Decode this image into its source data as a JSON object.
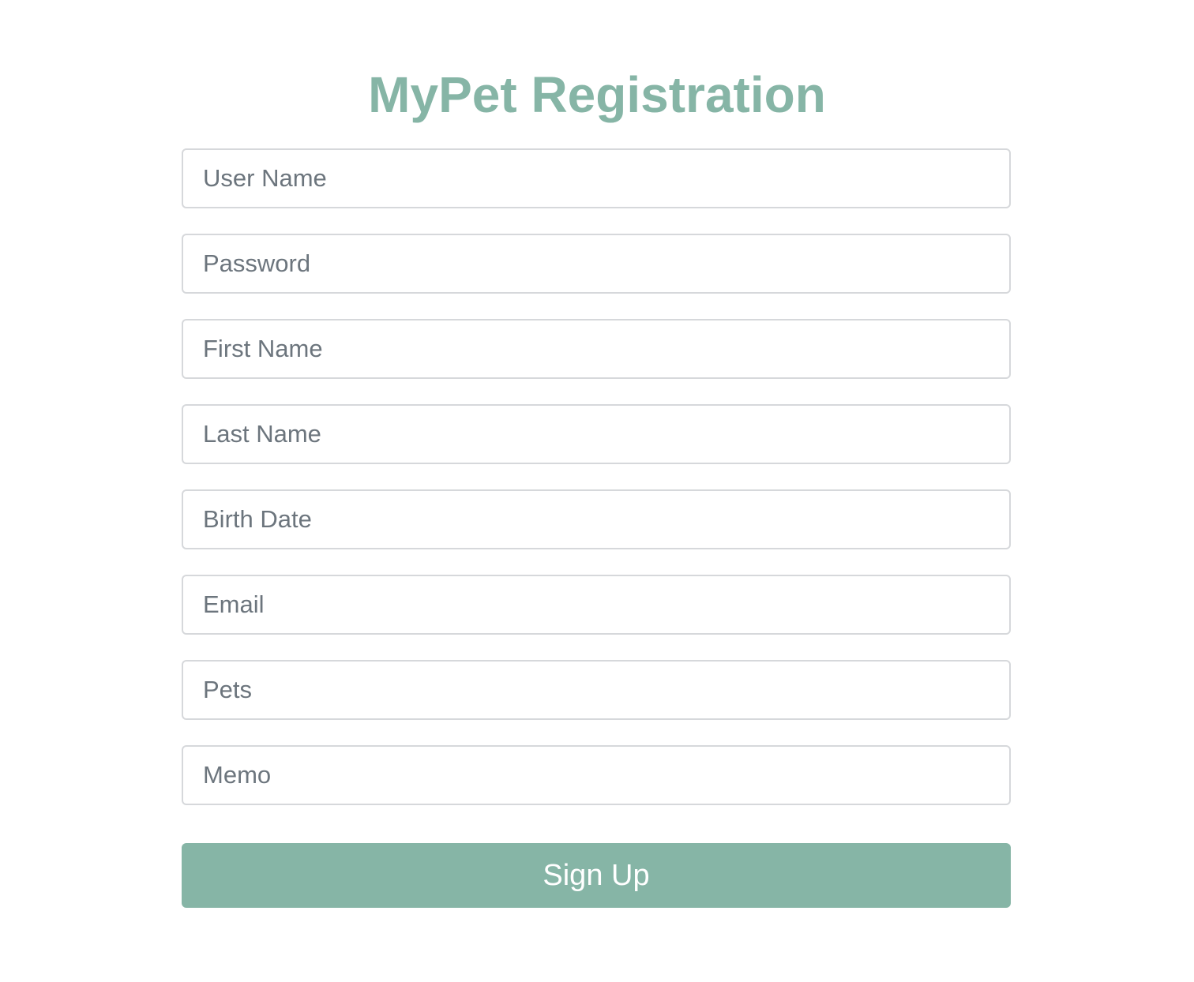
{
  "page": {
    "title": "MyPet Registration"
  },
  "form": {
    "fields": [
      {
        "name": "username",
        "placeholder": "User Name",
        "value": ""
      },
      {
        "name": "password",
        "placeholder": "Password",
        "value": ""
      },
      {
        "name": "first_name",
        "placeholder": "First Name",
        "value": ""
      },
      {
        "name": "last_name",
        "placeholder": "Last Name",
        "value": ""
      },
      {
        "name": "birth_date",
        "placeholder": "Birth Date",
        "value": ""
      },
      {
        "name": "email",
        "placeholder": "Email",
        "value": ""
      },
      {
        "name": "pets",
        "placeholder": "Pets",
        "value": ""
      },
      {
        "name": "memo",
        "placeholder": "Memo",
        "value": ""
      }
    ],
    "submit_label": "Sign Up"
  },
  "colors": {
    "accent": "#86b5a6",
    "border": "#d6d8db",
    "placeholder": "#6c757d",
    "background": "#ffffff"
  }
}
